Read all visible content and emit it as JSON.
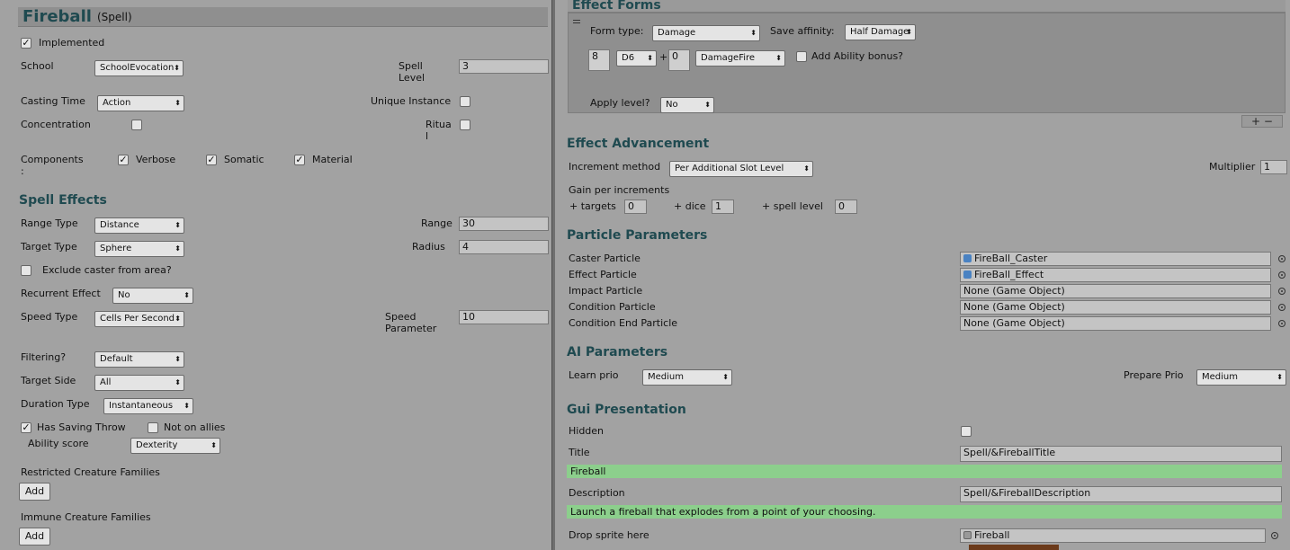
{
  "left": {
    "title": "Fireball",
    "title_sub": "(Spell)",
    "implemented": {
      "label": "Implemented",
      "checked": true
    },
    "school": {
      "label": "School",
      "value": "SchoolEvocation"
    },
    "spell_level": {
      "label_line1": "Spell",
      "label_line2": "Level",
      "value": "3"
    },
    "casting_time": {
      "label": "Casting Time",
      "value": "Action"
    },
    "unique_instance": {
      "label": "Unique Instance",
      "checked": false
    },
    "concentration": {
      "label": "Concentration",
      "checked": false
    },
    "ritual": {
      "label_line1": "Ritua",
      "label_line2": "l",
      "checked": false
    },
    "components": {
      "label_line1": "Components",
      "label_line2": ":",
      "verbose": {
        "label": "Verbose",
        "checked": true
      },
      "somatic": {
        "label": "Somatic",
        "checked": true
      },
      "material": {
        "label": "Material",
        "checked": true
      }
    },
    "spell_effects_header": "Spell Effects",
    "range_type": {
      "label": "Range Type",
      "value": "Distance"
    },
    "range": {
      "label": "Range",
      "value": "30"
    },
    "target_type": {
      "label": "Target Type",
      "value": "Sphere"
    },
    "radius": {
      "label": "Radius",
      "value": "4"
    },
    "exclude_caster": {
      "label": "Exclude caster from area?",
      "checked": false
    },
    "recurrent_effect": {
      "label": "Recurrent Effect",
      "value": "No"
    },
    "speed_type": {
      "label": "Speed Type",
      "value": "Cells Per Second"
    },
    "speed_parameter": {
      "label_line1": "Speed",
      "label_line2": "Parameter",
      "value": "10"
    },
    "filtering": {
      "label": "Filtering?",
      "value": "Default"
    },
    "target_side": {
      "label": "Target Side",
      "value": "All"
    },
    "duration_type": {
      "label": "Duration Type",
      "value": "Instantaneous"
    },
    "has_saving_throw": {
      "label": "Has Saving Throw",
      "checked": true
    },
    "not_on_allies": {
      "label": "Not on allies",
      "checked": false
    },
    "ability_score": {
      "label": "Ability score",
      "value": "Dexterity"
    },
    "restricted_families": {
      "label": "Restricted Creature Families",
      "button": "Add"
    },
    "immune_families": {
      "label": "Immune Creature Families",
      "button": "Add"
    }
  },
  "right": {
    "effect_forms_header": "Effect Forms",
    "form_type": {
      "label": "Form type:",
      "value": "Damage"
    },
    "save_affinity": {
      "label": "Save affinity:",
      "value": "Half Damage"
    },
    "dice_count": "8",
    "die_type": "D6",
    "plus_sign": "+",
    "bonus": "0",
    "damage_type": "DamageFire",
    "add_ability_bonus": {
      "label": "Add Ability bonus?",
      "checked": false
    },
    "apply_level": {
      "label": "Apply level?",
      "value": "No"
    },
    "plus_minus": "+  −",
    "effect_advancement_header": "Effect Advancement",
    "increment_method": {
      "label": "Increment method",
      "value": "Per Additional Slot Level"
    },
    "multiplier": {
      "label": "Multiplier",
      "value": "1"
    },
    "gain_per_increments": "Gain per increments",
    "targets": {
      "label": "+ targets",
      "value": "0"
    },
    "dice": {
      "label": "+ dice",
      "value": "1"
    },
    "spell_level": {
      "label": "+ spell level",
      "value": "0"
    },
    "particle_header": "Particle Parameters",
    "particles": [
      {
        "label": "Caster Particle",
        "value": "FireBall_Caster",
        "icon": true
      },
      {
        "label": "Effect Particle",
        "value": "FireBall_Effect",
        "icon": true
      },
      {
        "label": "Impact Particle",
        "value": "None (Game Object)",
        "icon": false
      },
      {
        "label": "Condition Particle",
        "value": "None (Game Object)",
        "icon": false
      },
      {
        "label": "Condition End Particle",
        "value": "None (Game Object)",
        "icon": false
      }
    ],
    "ai_header": "AI Parameters",
    "learn_prio": {
      "label": "Learn prio",
      "value": "Medium"
    },
    "prepare_prio": {
      "label": "Prepare Prio",
      "value": "Medium"
    },
    "gui_header": "Gui Presentation",
    "hidden": {
      "label": "Hidden",
      "checked": false
    },
    "title": {
      "label": "Title",
      "value": "Spell/&FireballTitle",
      "resolved": "Fireball"
    },
    "description": {
      "label": "Description",
      "value": "Spell/&FireballDescription",
      "resolved": "Launch a fireball that explodes from a point of your choosing."
    },
    "drop_sprite": {
      "label": "Drop sprite here",
      "value": "Fireball"
    }
  },
  "colors": {
    "background": "#a2a2a2",
    "header": "#1f4a50",
    "translation_green": "#8ccf8c"
  },
  "icons": [
    "dropdown-arrow-icon",
    "object-picker-icon",
    "prefab-icon",
    "sprite-icon",
    "checkmark-icon",
    "reorder-handle-icon"
  ]
}
